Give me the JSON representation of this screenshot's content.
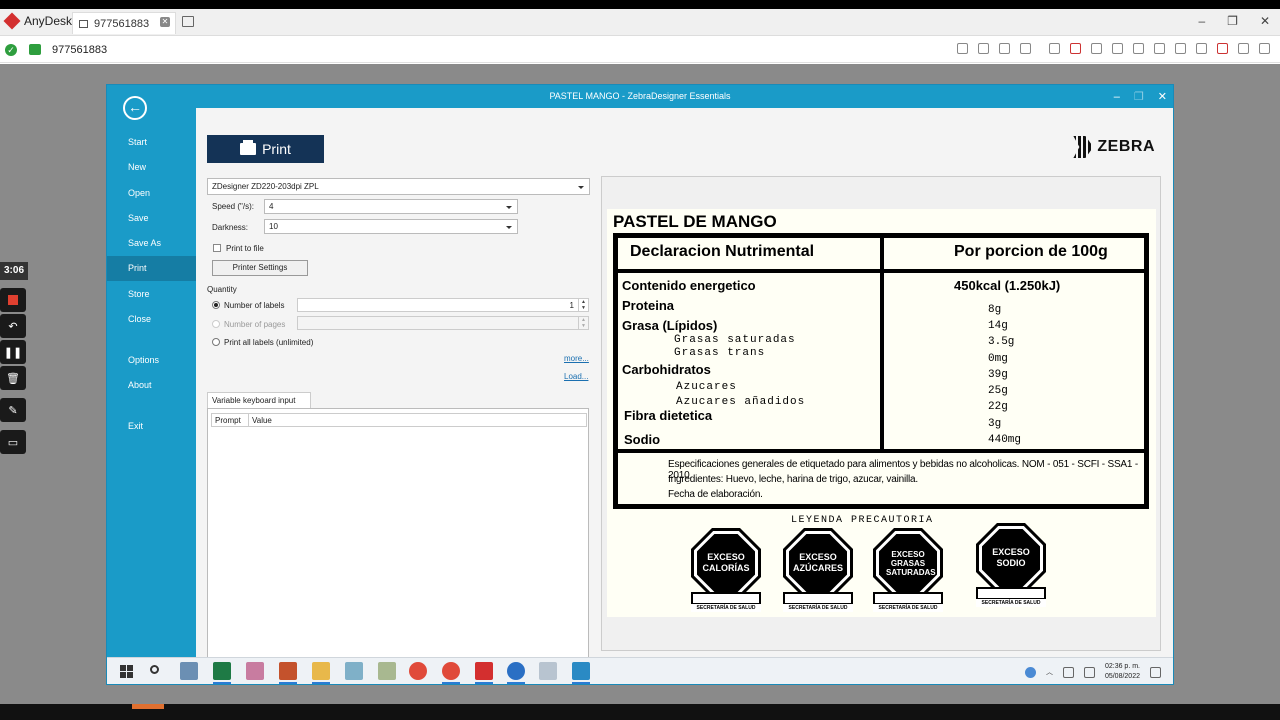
{
  "anydesk": {
    "app_name": "AnyDesk",
    "tab_label": "977561883",
    "address": "977561883",
    "side_time": "3:06"
  },
  "window": {
    "title": "PASTEL MANGO - ZebraDesigner Essentials",
    "back_icon": "arrow-left-icon"
  },
  "menu": [
    "Start",
    "New",
    "Open",
    "Save",
    "Save As",
    "Print",
    "Store",
    "Close",
    "Options",
    "About",
    "Exit"
  ],
  "active_menu": "Print",
  "print_panel": {
    "print_button": "Print",
    "brand": "ZEBRA",
    "printer": "ZDesigner ZD220-203dpi ZPL",
    "speed_label": "Speed (\"/s):",
    "speed_value": "4",
    "darkness_label": "Darkness:",
    "darkness_value": "10",
    "print_to_file": "Print to file",
    "printer_settings": "Printer Settings",
    "quantity_label": "Quantity",
    "number_of_labels": "Number of labels",
    "number_of_labels_value": "1",
    "number_of_pages": "Number of pages",
    "print_all_labels": "Print all labels (unlimited)",
    "more_link": "more...",
    "load_link": "Load...",
    "tab_label": "Variable keyboard input",
    "col_prompt": "Prompt",
    "col_value": "Value"
  },
  "label": {
    "title": "PASTEL DE MANGO",
    "header_left": "Declaracion Nutrimental",
    "header_right": "Por porcion de 100g",
    "rows": {
      "energetico": "Contenido energetico",
      "energetico_val": "450kcal (1.250kJ)",
      "proteina": "Proteina",
      "proteina_val": "8g",
      "grasa": "Grasa (Lípidos)",
      "grasa_val": "14g",
      "saturadas": "Grasas saturadas",
      "saturadas_val": "3.5g",
      "trans": "Grasas trans",
      "trans_val": "0mg",
      "carbohidratos": "Carbohidratos",
      "carbohidratos_val": "39g",
      "azucares": "Azucares",
      "azucares_val": "25g",
      "anadidos": "Azucares añadidos",
      "anadidos_val": "22g",
      "fibra": "Fibra dietetica",
      "fibra_val": "3g",
      "sodio": "Sodio",
      "sodio_val": "440mg"
    },
    "footer1": "Especificaciones generales de etiquetado para alimentos y bebidas no alcoholicas. NOM - 051 - SCFI - SSA1 - 2010.",
    "footer2": "Ingredientes: Huevo, leche, harina de trigo, azucar, vainilla.",
    "footer3": "Fecha de elaboración.",
    "leyenda": "LEYENDA PRECAUTORIA",
    "seals": [
      {
        "line1": "EXCESO",
        "line2": "CALORÍAS",
        "foot": "SECRETARÍA DE SALUD"
      },
      {
        "line1": "EXCESO",
        "line2": "AZÚCARES",
        "foot": "SECRETARÍA DE SALUD"
      },
      {
        "line1": "EXCESO",
        "line2": "GRASAS SATURADAS",
        "foot": "SECRETARÍA DE SALUD"
      },
      {
        "line1": "EXCESO",
        "line2": "SODIO",
        "foot": "SECRETARÍA DE SALUD"
      }
    ]
  },
  "taskbar": {
    "time": "02:36 p. m.",
    "date": "05/08/2022"
  }
}
